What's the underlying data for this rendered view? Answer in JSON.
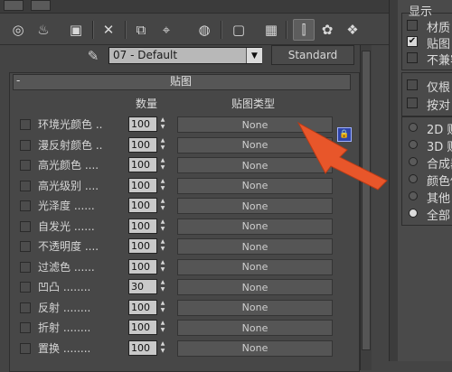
{
  "material": {
    "name": "07 - Default",
    "type_button": "Standard"
  },
  "rollout": {
    "collapse": "-",
    "title": "贴图"
  },
  "columns": {
    "amount": "数量",
    "map_type": "贴图类型"
  },
  "map_rows": [
    {
      "label": "环境光颜色 ..",
      "amount": "100",
      "map": "None",
      "checked": false
    },
    {
      "label": "漫反射颜色 ..",
      "amount": "100",
      "map": "None",
      "checked": false
    },
    {
      "label": "高光颜色 ....",
      "amount": "100",
      "map": "None",
      "checked": false
    },
    {
      "label": "高光级别 ....",
      "amount": "100",
      "map": "None",
      "checked": false
    },
    {
      "label": "光泽度 ......",
      "amount": "100",
      "map": "None",
      "checked": false
    },
    {
      "label": "自发光 ......",
      "amount": "100",
      "map": "None",
      "checked": false
    },
    {
      "label": "不透明度 ....",
      "amount": "100",
      "map": "None",
      "checked": false
    },
    {
      "label": "过滤色 ......",
      "amount": "100",
      "map": "None",
      "checked": false
    },
    {
      "label": "凹凸 ........",
      "amount": "30",
      "map": "None",
      "checked": false
    },
    {
      "label": "反射 ........",
      "amount": "100",
      "map": "None",
      "checked": false
    },
    {
      "label": "折射 ........",
      "amount": "100",
      "map": "None",
      "checked": false
    },
    {
      "label": "置换 ........",
      "amount": "100",
      "map": "None",
      "checked": false
    }
  ],
  "right_panel": {
    "section_title": "显示",
    "checks": [
      {
        "label": "材质",
        "checked": false
      },
      {
        "label": "贴图",
        "checked": true
      },
      {
        "label": "不兼容",
        "checked": false
      }
    ],
    "checks2": [
      {
        "label": "仅根",
        "checked": false
      },
      {
        "label": "按对",
        "checked": false
      }
    ],
    "radios": [
      {
        "label": "2D 贴",
        "selected": false
      },
      {
        "label": "3D 贴",
        "selected": false
      },
      {
        "label": "合成器",
        "selected": false
      },
      {
        "label": "颜色修",
        "selected": false
      },
      {
        "label": "其他",
        "selected": false
      },
      {
        "label": "全部",
        "selected": true
      }
    ]
  },
  "icons": {
    "toolbar": [
      "sphere-icon",
      "teapot-icon",
      "cube-icon",
      "delete-x-icon",
      "copy-icon",
      "pick-icon",
      "globe-icon",
      "select-icon",
      "checker-icon",
      "show-end-icon",
      "material-map-icon",
      "options-icon"
    ],
    "lock": "lock-icon",
    "arrow": "red-arrow-annotation",
    "eyedropper": "eyedropper-icon"
  },
  "colors": {
    "arrow": "#e8562a",
    "lock": "#2e44a8",
    "background": "#444444"
  }
}
